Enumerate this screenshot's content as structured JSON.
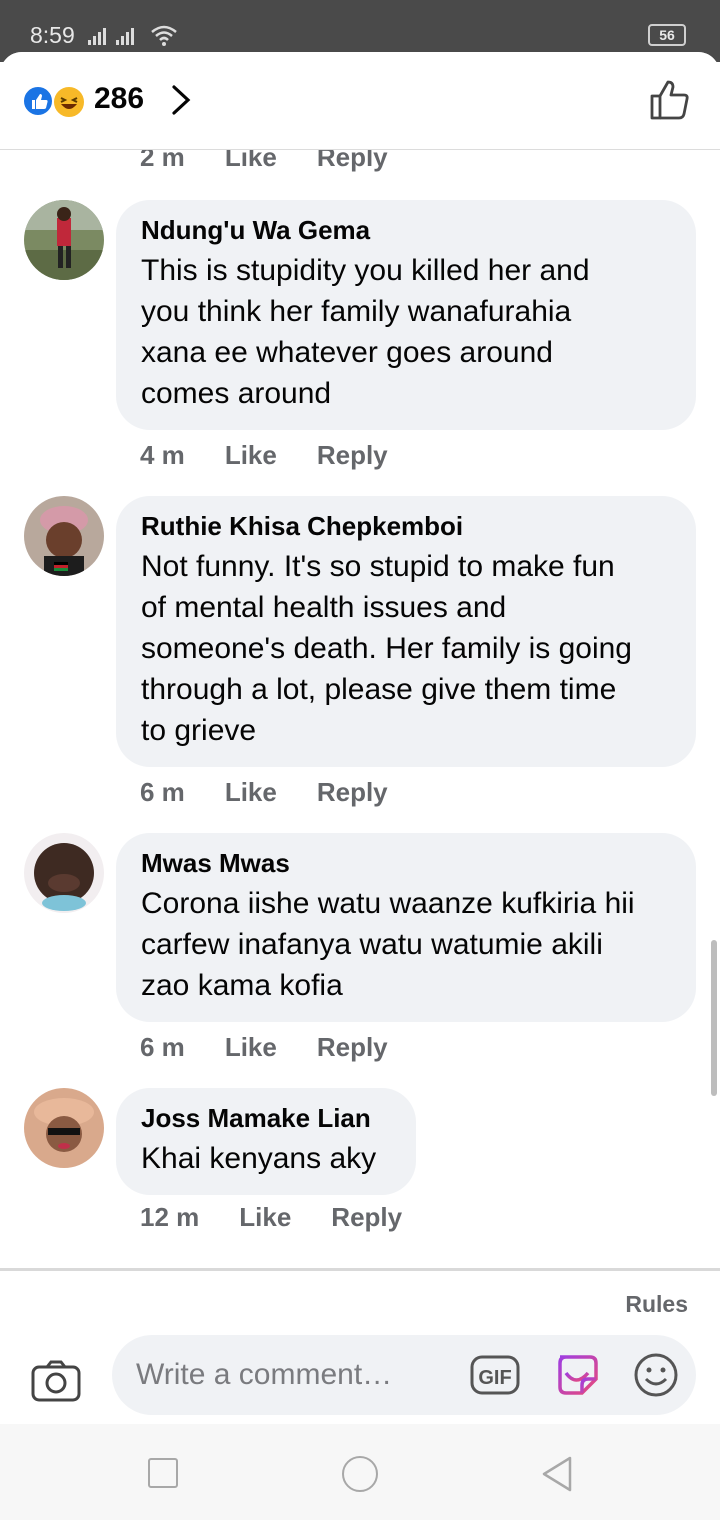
{
  "status_bar": {
    "time": "8:59",
    "battery": "56"
  },
  "header": {
    "reaction_count": "286"
  },
  "top_meta": {
    "time": "2 m",
    "like": "Like",
    "reply": "Reply"
  },
  "comments": [
    {
      "author": "Ndung'u Wa Gema",
      "text_lines": [
        "This is stupidity you killed her and",
        "you think her family wanafurahia",
        "xana ee whatever goes around",
        "comes around"
      ],
      "time": "4 m",
      "like": "Like",
      "reply": "Reply"
    },
    {
      "author": "Ruthie Khisa Chepkemboi",
      "text_lines": [
        "Not funny. It's so stupid to make fun",
        "of mental health issues and",
        "someone's death. Her family is going",
        "through a lot, please give them time",
        "to grieve"
      ],
      "time": "6 m",
      "like": "Like",
      "reply": "Reply"
    },
    {
      "author": "Mwas Mwas",
      "text_lines": [
        "Corona iishe watu waanze kufkiria hii",
        "carfew inafanya watu watumie akili",
        "zao kama kofia"
      ],
      "time": "6 m",
      "like": "Like",
      "reply": "Reply"
    },
    {
      "author": "Joss Mamake Lian",
      "text_lines": [
        "Khai kenyans aky"
      ],
      "time": "12 m",
      "like": "Like",
      "reply": "Reply"
    }
  ],
  "footer": {
    "rules": "Rules",
    "placeholder": "Write a comment…",
    "gif": "GIF"
  },
  "colors": {
    "like_blue": "#1b74e4",
    "haha_yellow": "#f7b928",
    "bubble_bg": "#f0f2f5",
    "meta_gray": "#65676b"
  }
}
